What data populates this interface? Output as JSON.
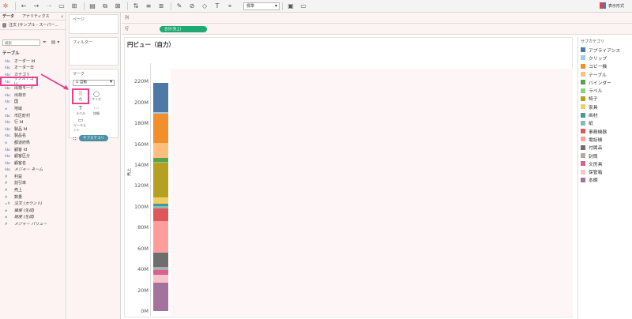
{
  "toolbar": {
    "icons": [
      "tableau-logo-icon",
      "undo-icon",
      "redo-icon",
      "save-icon",
      "new-datasource-icon",
      "new-worksheet-icon",
      "swap-icon",
      "sort-asc-icon",
      "sort-desc-icon",
      "highlight-icon",
      "group-icon",
      "label-icon",
      "text-icon",
      "fit-icon",
      "present-icon"
    ],
    "fit_value": "標準",
    "show_me_label": "表示形式"
  },
  "data_pane": {
    "tabs": [
      "データ",
      "アナリティクス"
    ],
    "datasource": "注文 (サンプル - スーパー...",
    "search_placeholder": "検索",
    "table_label": "テーブル",
    "fields": [
      {
        "type": "Abc",
        "name": "オーダー Id",
        "kind": "dim"
      },
      {
        "type": "Abc",
        "name": "オーダー日",
        "kind": "dim"
      },
      {
        "type": "Abc",
        "name": "カテゴリ",
        "kind": "dim"
      },
      {
        "type": "Abc",
        "name": "サブカテゴリ",
        "kind": "dim",
        "highlight": true
      },
      {
        "type": "Abc",
        "name": "出荷モード",
        "kind": "dim"
      },
      {
        "type": "Abc",
        "name": "出荷日",
        "kind": "dim"
      },
      {
        "type": "Abc",
        "name": "国",
        "kind": "dim"
      },
      {
        "type": "⊕",
        "name": "地域",
        "kind": "geo"
      },
      {
        "type": "Abc",
        "name": "市区町村",
        "kind": "dim"
      },
      {
        "type": "Abc",
        "name": "行 Id",
        "kind": "dim"
      },
      {
        "type": "Abc",
        "name": "製品 Id",
        "kind": "dim"
      },
      {
        "type": "Abc",
        "name": "製品名",
        "kind": "dim"
      },
      {
        "type": "⊕",
        "name": "都道府県",
        "kind": "geo"
      },
      {
        "type": "Abc",
        "name": "顧客 Id",
        "kind": "dim"
      },
      {
        "type": "Abc",
        "name": "顧客区分",
        "kind": "dim"
      },
      {
        "type": "Abc",
        "name": "顧客名",
        "kind": "dim"
      },
      {
        "type": "Abc",
        "name": "メジャー ネーム",
        "kind": "dim",
        "italic": true
      },
      {
        "type": "#",
        "name": "利益",
        "kind": "num"
      },
      {
        "type": "#",
        "name": "割引率",
        "kind": "num"
      },
      {
        "type": "#",
        "name": "売上",
        "kind": "num"
      },
      {
        "type": "#",
        "name": "数量",
        "kind": "num"
      },
      {
        "type": "=#",
        "name": "注文 (カウント)",
        "kind": "num",
        "italic": true
      },
      {
        "type": "⊕",
        "name": "緯度 (生成)",
        "kind": "num",
        "italic": true
      },
      {
        "type": "⊕",
        "name": "経度 (生成)",
        "kind": "num",
        "italic": true
      },
      {
        "type": "#",
        "name": "メジャー バリュー",
        "kind": "num",
        "italic": true
      }
    ]
  },
  "shelves": {
    "pages_label": "ページ",
    "filters_label": "フィルター",
    "marks_label": "マーク",
    "mark_type": "自動",
    "mark_buttons": [
      {
        "name": "color",
        "label": "色",
        "icon": "⠿",
        "highlight": true
      },
      {
        "name": "size",
        "label": "サイズ",
        "icon": "◯"
      },
      {
        "name": "label",
        "label": "ラベル",
        "icon": "T"
      },
      {
        "name": "detail",
        "label": "詳細",
        "icon": "⋯"
      },
      {
        "name": "tooltip",
        "label": "ツールヒント",
        "icon": "▭"
      }
    ],
    "color_pill": "サブカテゴリ",
    "columns_label": "列",
    "rows_label": "行",
    "rows_pill": "合計(売上)"
  },
  "view": {
    "title": "円ビュー（自力）"
  },
  "chart_data": {
    "type": "bar",
    "stacked": true,
    "ylabel": "売上",
    "ylim": [
      0,
      230000000
    ],
    "yticks": [
      "0M",
      "20M",
      "40M",
      "60M",
      "80M",
      "100M",
      "120M",
      "140M",
      "160M",
      "180M",
      "200M",
      "220M"
    ],
    "series": [
      {
        "name": "本棚",
        "value": 27000000,
        "color": "#a5729e"
      },
      {
        "name": "保管箱",
        "value": 8000000,
        "color": "#f7c4cc"
      },
      {
        "name": "文房具",
        "value": 4000000,
        "color": "#d3648f"
      },
      {
        "name": "封筒",
        "value": 3000000,
        "color": "#b0aba8"
      },
      {
        "name": "付属品",
        "value": 14000000,
        "color": "#6e6e6e"
      },
      {
        "name": "電話機",
        "value": 30000000,
        "color": "#ff9d9a"
      },
      {
        "name": "事務機器",
        "value": 12000000,
        "color": "#e15759"
      },
      {
        "name": "紙",
        "value": 3000000,
        "color": "#86bcb6"
      },
      {
        "name": "画材",
        "value": 2000000,
        "color": "#499894"
      },
      {
        "name": "家具",
        "value": 6000000,
        "color": "#f1ce63"
      },
      {
        "name": "椅子",
        "value": 33000000,
        "color": "#b5a021"
      },
      {
        "name": "ラベル",
        "value": 1000000,
        "color": "#8cd17d"
      },
      {
        "name": "バインダー",
        "value": 4000000,
        "color": "#59a14f"
      },
      {
        "name": "テーブル",
        "value": 14000000,
        "color": "#ffbe7d"
      },
      {
        "name": "コピー機",
        "value": 28000000,
        "color": "#f28e2b"
      },
      {
        "name": "クリップ",
        "value": 2000000,
        "color": "#a0cbe8"
      },
      {
        "name": "アプライアンス",
        "value": 28000000,
        "color": "#4e79a7"
      }
    ]
  },
  "legend": {
    "title": "サブカテゴリ",
    "items": [
      {
        "name": "アプライアンス",
        "color": "#4e79a7"
      },
      {
        "name": "クリップ",
        "color": "#a0cbe8"
      },
      {
        "name": "コピー機",
        "color": "#f28e2b"
      },
      {
        "name": "テーブル",
        "color": "#ffbe7d"
      },
      {
        "name": "バインダー",
        "color": "#59a14f"
      },
      {
        "name": "ラベル",
        "color": "#8cd17d"
      },
      {
        "name": "椅子",
        "color": "#b5a021"
      },
      {
        "name": "家具",
        "color": "#f1ce63"
      },
      {
        "name": "画材",
        "color": "#499894"
      },
      {
        "name": "紙",
        "color": "#86bcb6"
      },
      {
        "name": "事務機器",
        "color": "#e15759"
      },
      {
        "name": "電話機",
        "color": "#ff9d9a"
      },
      {
        "name": "付属品",
        "color": "#6e6e6e"
      },
      {
        "name": "封筒",
        "color": "#b0aba8"
      },
      {
        "name": "文房具",
        "color": "#d3648f"
      },
      {
        "name": "保管箱",
        "color": "#f7c4cc"
      },
      {
        "name": "本棚",
        "color": "#a5729e"
      }
    ]
  },
  "accent_color": "#e83e8c"
}
